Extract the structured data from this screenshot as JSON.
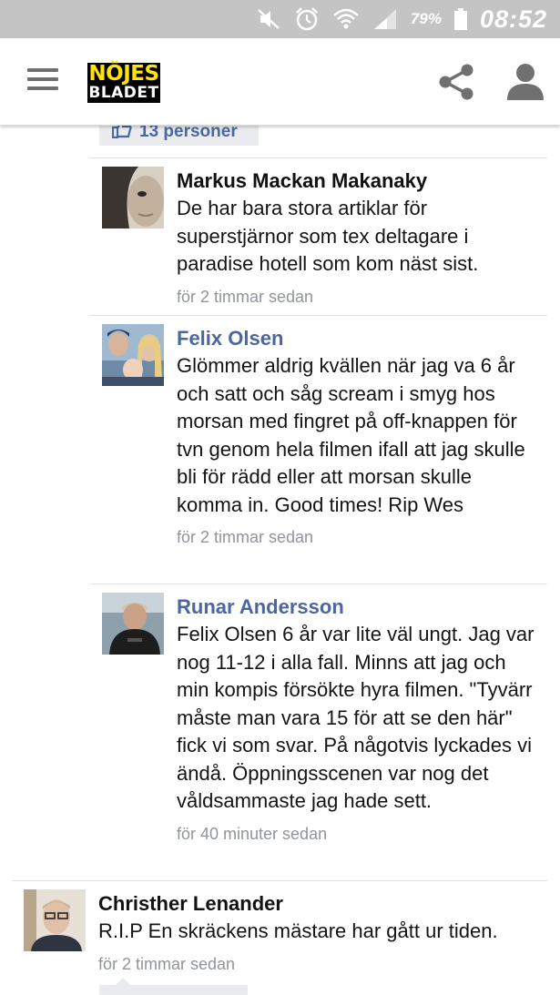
{
  "status_bar": {
    "battery_percent": "79%",
    "time": "08:52",
    "icons": [
      "mute-icon",
      "alarm-icon",
      "wifi-icon",
      "signal-icon",
      "battery-icon"
    ]
  },
  "header": {
    "menu_icon": "hamburger-menu-icon",
    "logo_line1": "NÖJES",
    "logo_line2": "BLADET",
    "share_icon": "share-icon",
    "profile_icon": "user-profile-icon",
    "colors": {
      "logo_yellow": "#ffe500",
      "logo_black": "#000000"
    }
  },
  "likes": {
    "label": "13 personer",
    "icon": "thumbs-up-icon"
  },
  "comments": [
    {
      "author": "Markus Mackan Makanaky",
      "text": "De har bara stora artiklar för superstjärnor som tex deltagare i paradise hotell som kom näst sist.",
      "time": "för 2 timmar sedan"
    },
    {
      "author": "Felix Olsen",
      "text": "Glömmer aldrig kvällen när jag va 6 år och satt och såg scream i smyg hos morsan med fingret på off-knappen för tvn genom hela filmen ifall att jag skulle bli för rädd eller att morsan skulle komma in. Good times! Rip Wes",
      "time": "för 2 timmar sedan"
    },
    {
      "author": "Runar Andersson",
      "text": "Felix Olsen 6 år var lite väl ungt. Jag var nog 11-12 i alla fall. Minns att jag och min kompis försökte hyra filmen. \"Tyvärr måste man vara 15 för att se den här\" fick vi som svar. På någotvis lyckades vi ändå. Öppningsscenen var nog det våldsammaste jag hade sett.",
      "time": "för 40 minuter sedan"
    },
    {
      "author": "Christher Lenander",
      "text": "R.I.P En skräckens mästare har gått ur tiden.",
      "time": "för 2 timmar sedan"
    }
  ],
  "colors": {
    "status_bar": "#c4c4c4",
    "link_blue": "#4b67a1",
    "timestamp_gray": "#90949c",
    "like_box_bg": "#e9ebee"
  }
}
